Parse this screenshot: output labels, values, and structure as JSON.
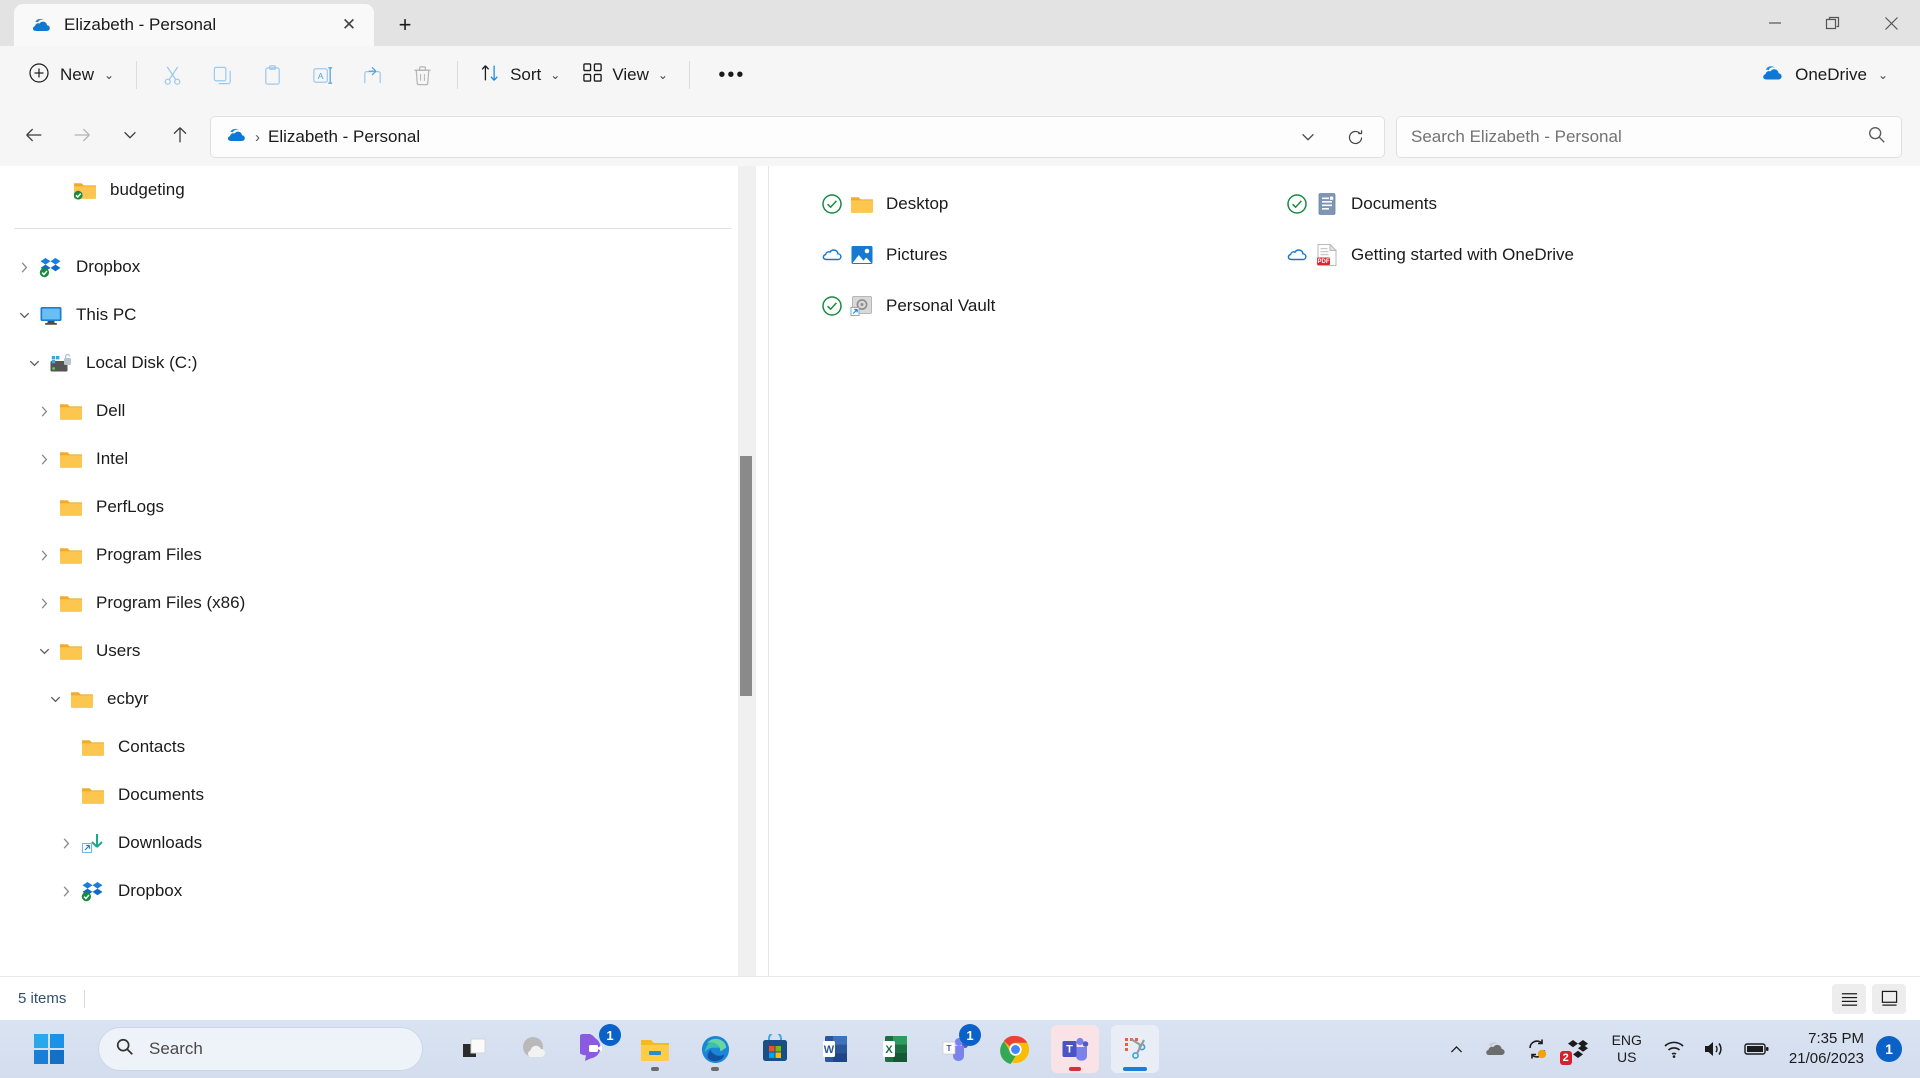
{
  "window": {
    "tab_title": "Elizabeth - Personal",
    "tab_icon": "onedrive-cloud-icon",
    "close_tab": "✕",
    "new_tab": "+",
    "minimize": "−",
    "restore": "❐",
    "close": "✕"
  },
  "toolbar": {
    "new_label": "New",
    "cut_icon": "scissors-icon",
    "copy_icon": "copy-icon",
    "paste_icon": "paste-icon",
    "rename_icon": "rename-icon",
    "share_icon": "share-icon",
    "delete_icon": "trash-icon",
    "sort_label": "Sort",
    "view_label": "View",
    "more_label": "•••",
    "onedrive_label": "OneDrive"
  },
  "address": {
    "back_icon": "arrow-left-icon",
    "forward_icon": "arrow-right-icon",
    "recent_icon": "chevron-down-icon",
    "up_icon": "arrow-up-icon",
    "breadcrumb_root_icon": "onedrive-cloud-icon",
    "breadcrumb_separator": "›",
    "breadcrumb_text": "Elizabeth - Personal",
    "dropdown_icon": "chevron-down-icon",
    "refresh_icon": "refresh-icon"
  },
  "search": {
    "placeholder": "Search Elizabeth - Personal",
    "icon": "search-icon"
  },
  "sidebar": {
    "top_items": [
      {
        "label": "budgeting",
        "icon": "folder-synced-icon",
        "indent": 44,
        "chevron": ""
      }
    ],
    "items": [
      {
        "label": "Dropbox",
        "icon": "dropbox-synced-icon",
        "indent": 10,
        "chevron": "›"
      },
      {
        "label": "This PC",
        "icon": "monitor-icon",
        "indent": 10,
        "chevron": "⌄"
      },
      {
        "label": "Local Disk (C:)",
        "icon": "drive-icon",
        "indent": 20,
        "chevron": "⌄"
      },
      {
        "label": "Dell",
        "icon": "folder-icon",
        "indent": 30,
        "chevron": "›"
      },
      {
        "label": "Intel",
        "icon": "folder-icon",
        "indent": 30,
        "chevron": "›"
      },
      {
        "label": "PerfLogs",
        "icon": "folder-icon",
        "indent": 30,
        "chevron": ""
      },
      {
        "label": "Program Files",
        "icon": "folder-icon",
        "indent": 30,
        "chevron": "›"
      },
      {
        "label": "Program Files (x86)",
        "icon": "folder-icon",
        "indent": 30,
        "chevron": "›"
      },
      {
        "label": "Users",
        "icon": "folder-icon",
        "indent": 30,
        "chevron": "⌄"
      },
      {
        "label": "ecbyr",
        "icon": "folder-icon",
        "indent": 41,
        "chevron": "⌄"
      },
      {
        "label": "Contacts",
        "icon": "folder-icon",
        "indent": 52,
        "chevron": ""
      },
      {
        "label": "Documents",
        "icon": "folder-icon",
        "indent": 52,
        "chevron": ""
      },
      {
        "label": "Downloads",
        "icon": "downloads-shortcut-icon",
        "indent": 52,
        "chevron": "›"
      },
      {
        "label": "Dropbox",
        "icon": "dropbox-synced-icon",
        "indent": 52,
        "chevron": "›"
      }
    ]
  },
  "files": {
    "column1": [
      {
        "label": "Desktop",
        "icon": "folder-icon",
        "status": "synced-check-icon"
      },
      {
        "label": "Pictures",
        "icon": "pictures-folder-icon",
        "status": "cloud-online-icon"
      },
      {
        "label": "Personal Vault",
        "icon": "vault-shortcut-icon",
        "status": "synced-check-icon"
      }
    ],
    "column2": [
      {
        "label": "Documents",
        "icon": "documents-folder-icon",
        "status": "synced-check-icon"
      },
      {
        "label": "Getting started with OneDrive",
        "icon": "pdf-file-icon",
        "status": "cloud-online-icon"
      }
    ]
  },
  "status": {
    "item_count": "5 items",
    "details_view_icon": "details-view-icon",
    "large_icons_view_icon": "large-icons-view-icon"
  },
  "taskbar": {
    "start_icon": "windows-start-icon",
    "search_placeholder": "Search",
    "search_icon": "search-icon",
    "apps": [
      {
        "name": "task-view",
        "badge": "",
        "state": ""
      },
      {
        "name": "weather",
        "badge": "",
        "state": ""
      },
      {
        "name": "chat",
        "badge": "1",
        "state": ""
      },
      {
        "name": "file-explorer",
        "badge": "",
        "state": "open"
      },
      {
        "name": "microsoft-edge",
        "badge": "",
        "state": "open"
      },
      {
        "name": "microsoft-store",
        "badge": "",
        "state": ""
      },
      {
        "name": "word",
        "badge": "",
        "state": ""
      },
      {
        "name": "excel",
        "badge": "",
        "state": ""
      },
      {
        "name": "teams-chat",
        "badge": "1",
        "state": ""
      },
      {
        "name": "google-chrome",
        "badge": "",
        "state": ""
      },
      {
        "name": "microsoft-teams",
        "badge": "",
        "state": "active-pink"
      },
      {
        "name": "snipping-tool",
        "badge": "",
        "state": "active-blue"
      }
    ],
    "tray": {
      "overflow_icon": "chevron-up-icon",
      "onedrive_icon": "onedrive-gray-icon",
      "sync_icon": "sync-pending-icon",
      "dropbox_icon": "dropbox-tray-icon",
      "dropbox_badge": "2",
      "language_line1": "ENG",
      "language_line2": "US",
      "wifi_icon": "wifi-icon",
      "volume_icon": "volume-icon",
      "battery_icon": "battery-icon",
      "time": "7:35 PM",
      "date": "21/06/2023",
      "notification_badge": "1"
    }
  },
  "colors": {
    "onedrive_blue": "#0f78d4",
    "sync_green": "#1a8a3f",
    "accent_blue": "#0a62c8",
    "folder_yellow": "#f7c94b"
  }
}
